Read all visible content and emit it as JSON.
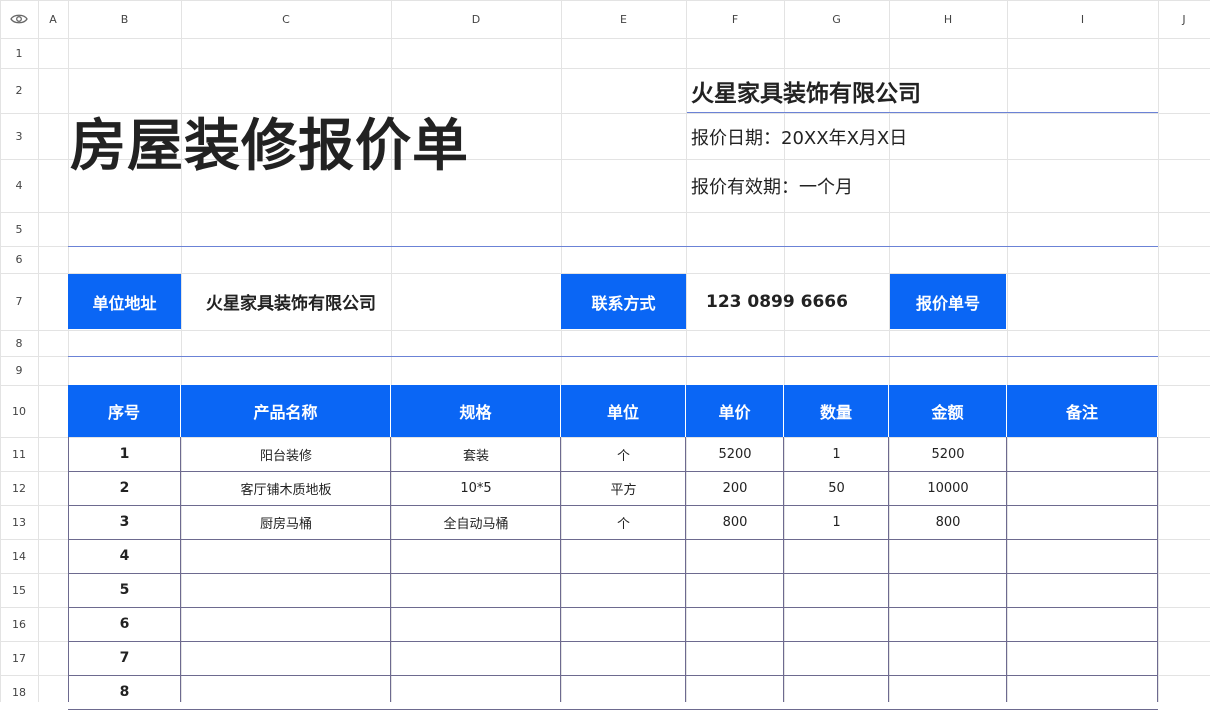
{
  "sheet": {
    "columns": [
      "A",
      "B",
      "C",
      "D",
      "E",
      "F",
      "G",
      "H",
      "I",
      "J"
    ],
    "rows": [
      "1",
      "2",
      "3",
      "4",
      "5",
      "6",
      "7",
      "8",
      "9",
      "10",
      "11",
      "12",
      "13",
      "14",
      "15",
      "16",
      "17",
      "18"
    ]
  },
  "header": {
    "title": "房屋装修报价单",
    "company": "火星家具装饰有限公司",
    "quote_date": "报价日期：20XX年X月X日",
    "validity": "报价有效期：一个月"
  },
  "info": {
    "address_label": "单位地址",
    "address_value": "火星家具装饰有限公司",
    "contact_label": "联系方式",
    "contact_value": "123 0899 6666",
    "quote_no_label": "报价单号",
    "quote_no_value": ""
  },
  "table": {
    "headers": [
      "序号",
      "产品名称",
      "规格",
      "单位",
      "单价",
      "数量",
      "金额",
      "备注"
    ],
    "rows": [
      [
        "1",
        "阳台装修",
        "套装",
        "个",
        "5200",
        "1",
        "5200",
        ""
      ],
      [
        "2",
        "客厅铺木质地板",
        "10*5",
        "平方",
        "200",
        "50",
        "10000",
        ""
      ],
      [
        "3",
        "厨房马桶",
        "全自动马桶",
        "个",
        "800",
        "1",
        "800",
        ""
      ],
      [
        "4",
        "",
        "",
        "",
        "",
        "",
        "",
        ""
      ],
      [
        "5",
        "",
        "",
        "",
        "",
        "",
        "",
        ""
      ],
      [
        "6",
        "",
        "",
        "",
        "",
        "",
        "",
        ""
      ],
      [
        "7",
        "",
        "",
        "",
        "",
        "",
        "",
        ""
      ],
      [
        "8",
        "",
        "",
        "",
        "",
        "",
        "",
        ""
      ]
    ]
  },
  "colors": {
    "accent": "#0a66f5",
    "border": "#6d6a8f",
    "line": "#6b82d6"
  }
}
